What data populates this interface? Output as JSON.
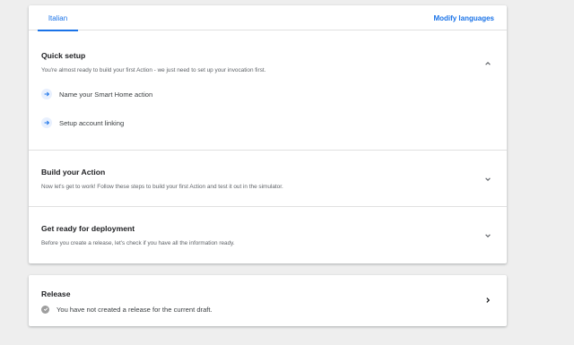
{
  "tabs": {
    "language_tab": "Italian",
    "modify_languages": "Modify languages"
  },
  "quick_setup": {
    "title": "Quick setup",
    "description": "You're almost ready to build your first Action - we just need to set up your invocation first.",
    "steps": [
      {
        "label": "Name your Smart Home action",
        "icon": "arrow-right-icon"
      },
      {
        "label": "Setup account linking",
        "icon": "arrow-right-icon"
      }
    ],
    "state_icon": "chevron-up-icon"
  },
  "build_action": {
    "title": "Build your Action",
    "description": "Now let's get to work! Follow these steps to build your first Action and test it out in the simulator.",
    "state_icon": "chevron-down-icon"
  },
  "deployment": {
    "title": "Get ready for deployment",
    "description": "Before you create a release, let's check if you have all the information ready.",
    "state_icon": "chevron-down-icon"
  },
  "release": {
    "title": "Release",
    "status": "You have not created a release for the current draft.",
    "status_icon": "check-circle-icon",
    "nav_icon": "chevron-right-icon"
  },
  "colors": {
    "accent": "#1a73e8",
    "background": "#eeeeee",
    "step_circle": "#e8f0fe",
    "status_icon": "#9e9e9e"
  }
}
